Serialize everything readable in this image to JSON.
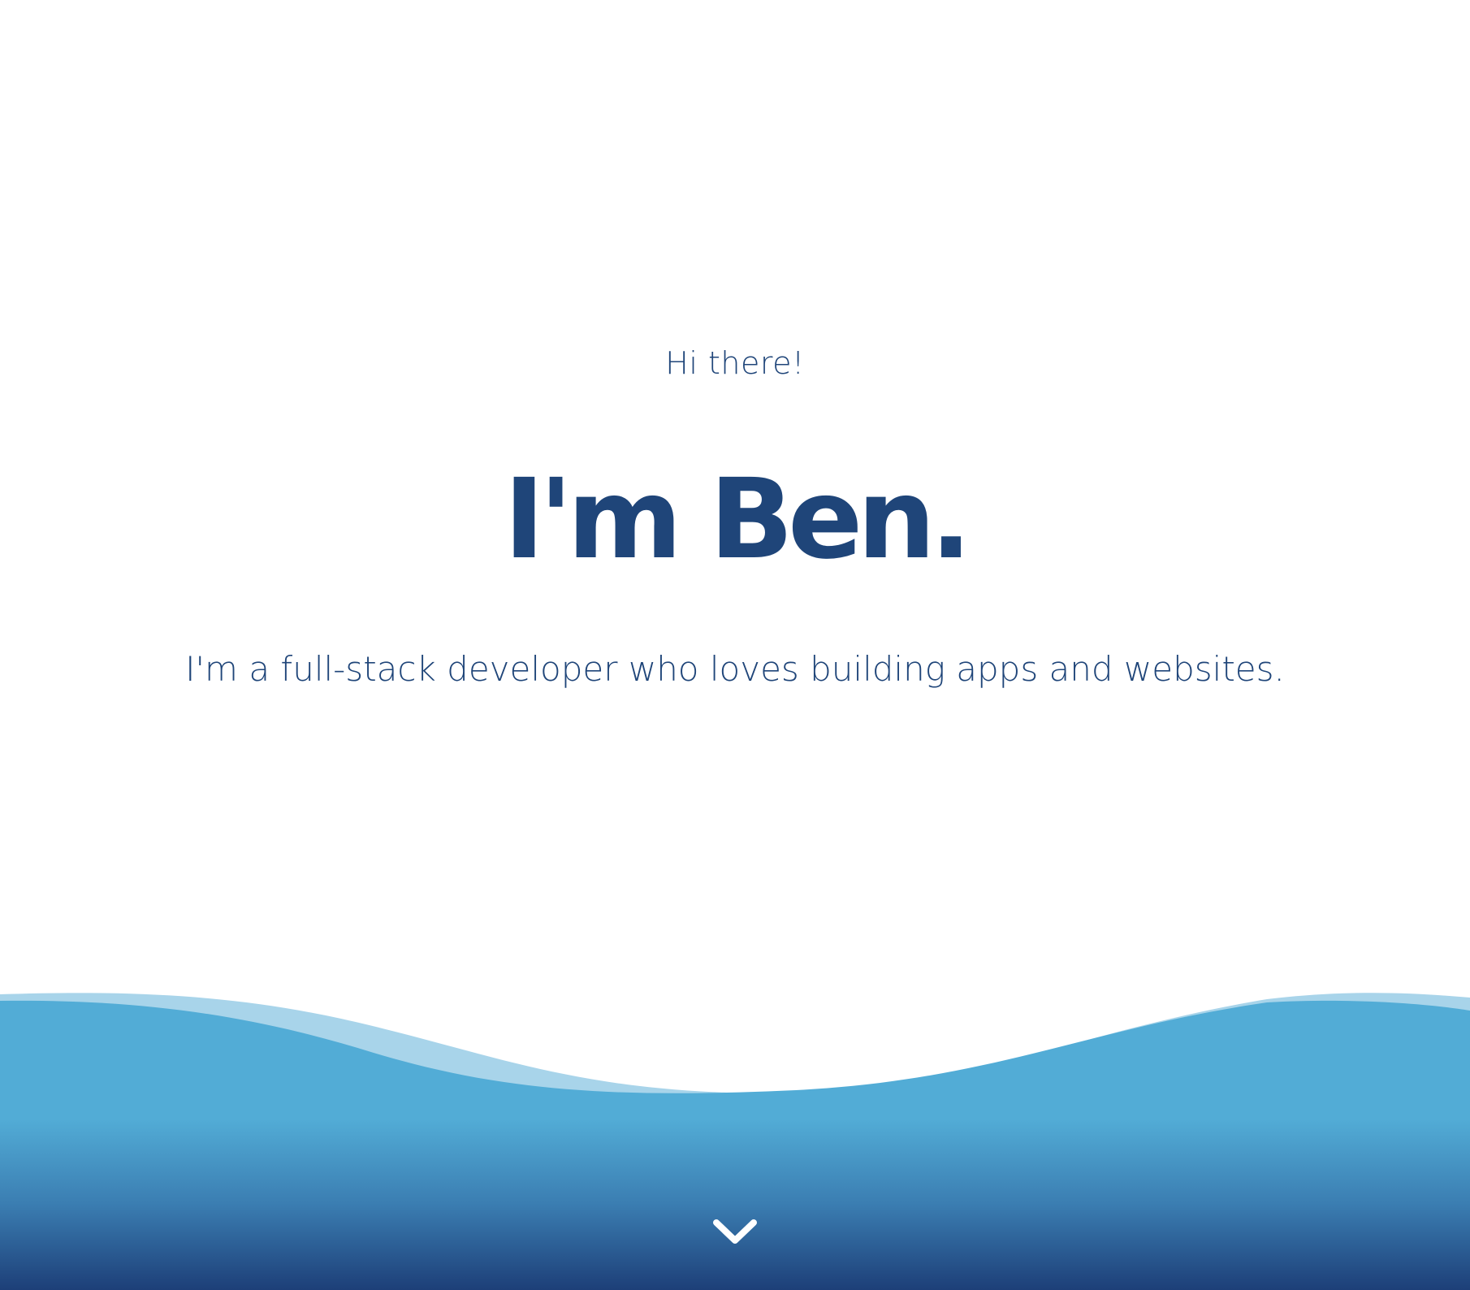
{
  "hero": {
    "greeting": "Hi there!",
    "name": "I'm Ben.",
    "tagline": "I'm a full-stack developer who loves building apps and websites."
  },
  "scroll_indicator": {
    "icon": "chevron-down-icon"
  },
  "colors": {
    "text": "#1f4579",
    "background": "#ffffff",
    "wave_light": "#a8d4ea",
    "wave_main": "#52acd6",
    "wave_deep": "#1d3f78",
    "icon": "#ffffff"
  }
}
